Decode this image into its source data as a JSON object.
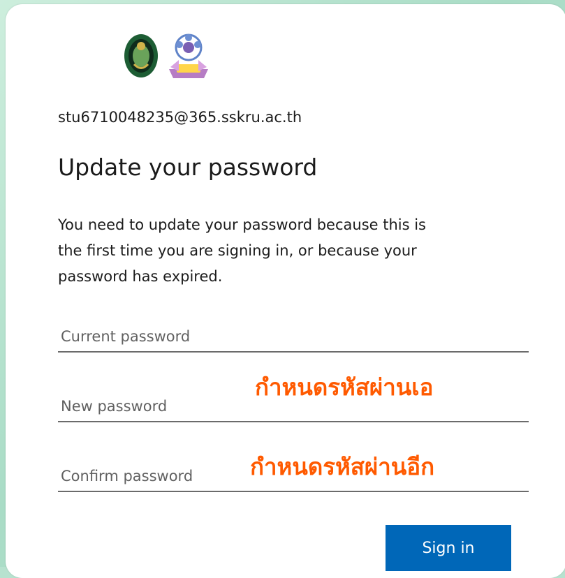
{
  "account": {
    "email": "stu6710048235@365.sskru.ac.th"
  },
  "header": {
    "title": "Update your password",
    "description_lines": [
      "You need to update your password because this is",
      "the first time you are signing in, or because your",
      "password has expired."
    ]
  },
  "form": {
    "current_password_placeholder": "Current password",
    "new_password_placeholder": "New password",
    "confirm_password_placeholder": "Confirm password",
    "sign_in_label": "Sign in"
  },
  "annotations": {
    "new_password_note": "กำหนดรหัสผ่านเอ",
    "confirm_password_note": "กำหนดรหัสผ่านอีก"
  },
  "logos": {
    "left": "university-seal-icon",
    "right": "arit-logo-icon"
  },
  "colors": {
    "primary_button": "#0067b8",
    "annotation_text": "#ff5a00",
    "page_background": "#b7e2cf"
  }
}
